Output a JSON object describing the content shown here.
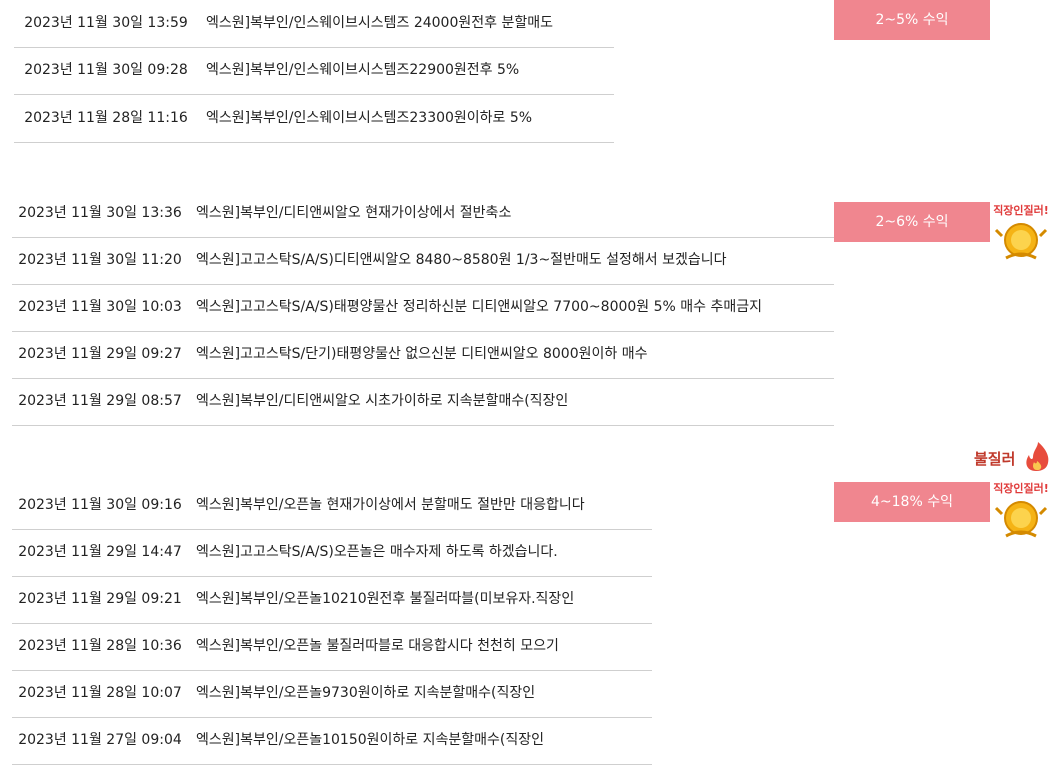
{
  "groups": [
    {
      "badge": "2~5% 수익",
      "rows": [
        {
          "date": "2023년 11월 30일 13:59",
          "text": "엑스원]복부인/인스웨이브시스템즈 24000원전후 분할매도"
        },
        {
          "date": "2023년 11월 30일 09:28",
          "text": "엑스원]복부인/인스웨이브시스템즈22900원전후 5%"
        },
        {
          "date": "2023년 11월 28일 11:16",
          "text": "엑스원]복부인/인스웨이브시스템즈23300원이하로 5%"
        }
      ]
    },
    {
      "badge": "2~6% 수익",
      "mascot_text": "직장인질러!",
      "rows": [
        {
          "date": "2023년 11월 30일 13:36",
          "text": "엑스원]복부인/디티앤씨알오 현재가이상에서 절반축소"
        },
        {
          "date": "2023년 11월 30일 11:20",
          "text": "엑스원]고고스탁S/A/S)디티앤씨알오 8480~8580원 1/3~절반매도 설정해서 보겠습니다"
        },
        {
          "date": "2023년 11월 30일 10:03",
          "text": "엑스원]고고스탁S/A/S)태평양물산 정리하신분 디티앤씨알오 7700~8000원 5% 매수 추매금지"
        },
        {
          "date": "2023년 11월 29일 09:27",
          "text": "엑스원]고고스탁S/단기)태평양물산 없으신분 디티앤씨알오 8000원이하 매수"
        },
        {
          "date": "2023년 11월 29일 08:57",
          "text": "엑스원]복부인/디티앤씨알오 시초가이하로 지속분할매수(직장인"
        }
      ]
    },
    {
      "badge": "4~18% 수익",
      "hot_text": "불질러",
      "mascot_text": "직장인질러!",
      "rows": [
        {
          "date": "2023년 11월 30일 09:16",
          "text": "엑스원]복부인/오픈놀 현재가이상에서 분할매도 절반만 대응합니다"
        },
        {
          "date": "2023년 11월 29일 14:47",
          "text": "엑스원]고고스탁S/A/S)오픈놀은 매수자제 하도록 하겠습니다."
        },
        {
          "date": "2023년 11월 29일 09:21",
          "text": "엑스원]복부인/오픈놀10210원전후 불질러따블(미보유자.직장인"
        },
        {
          "date": "2023년 11월 28일 10:36",
          "text": "엑스원]복부인/오픈놀 불질러따블로 대응합시다 천천히 모으기"
        },
        {
          "date": "2023년 11월 28일 10:07",
          "text": "엑스원]복부인/오픈놀9730원이하로 지속분할매수(직장인"
        },
        {
          "date": "2023년 11월 27일 09:04",
          "text": "엑스원]복부인/오픈놀10150원이하로 지속분할매수(직장인"
        }
      ]
    }
  ],
  "colors": {
    "badge_bg": "#f0868f",
    "divider": "#cfcfcf",
    "mascot": "#f5b315"
  }
}
